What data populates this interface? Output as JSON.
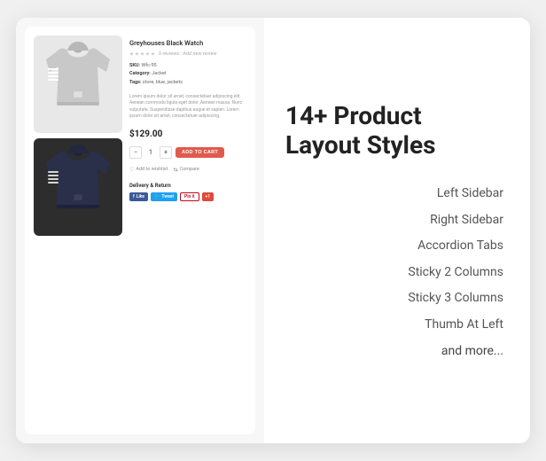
{
  "heading": "14+ Product\nLayout Styles",
  "layouts": [
    {
      "id": "left-sidebar",
      "label": "Left Sidebar"
    },
    {
      "id": "right-sidebar",
      "label": "Right Sidebar"
    },
    {
      "id": "accordion-tabs",
      "label": "Accordion Tabs"
    },
    {
      "id": "sticky-2-columns",
      "label": "Sticky 2 Columns"
    },
    {
      "id": "sticky-3-columns",
      "label": "Sticky 3 Columns"
    },
    {
      "id": "thumb-at-left",
      "label": "Thumb At Left"
    },
    {
      "id": "and-more",
      "label": "and more..."
    }
  ],
  "product": {
    "title": "Greyhouses Black Watch",
    "price": "$129.00",
    "qty": "1",
    "sku_label": "SKU:",
    "sku_value": "Wfc-95",
    "category_label": "Category:",
    "category_value": "Jacket",
    "tags_label": "Tags:",
    "tags_value": "store, blue, jackets",
    "description": "Lorem ipsum dolor sit amet, consectetuer adipiscing elit. Aenean commodo ligula eget dolor. Aenean massa. Nunc vulputate. Suspendisse dapibus augue et sapien. Lorem ipsum dolor sit amet, consectetuer adipiscing.",
    "add_to_cart": "ADD TO CART",
    "wishlist": "Add to wishlist",
    "compare": "Compare",
    "delivery_title": "Delivery & Return",
    "social": {
      "fb": "Like",
      "tw": "Tweet",
      "pi": "Pin it",
      "gp": "+1"
    }
  }
}
